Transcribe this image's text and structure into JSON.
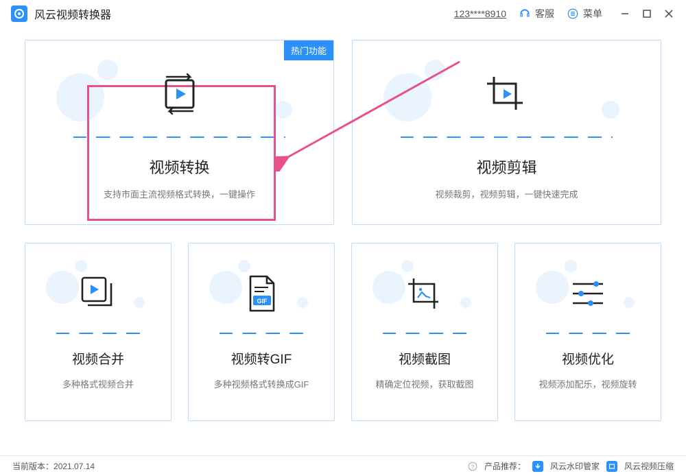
{
  "app": {
    "title": "风云视频转换器"
  },
  "header": {
    "phone": "123****8910",
    "support": "客服",
    "menu": "菜单"
  },
  "badge": "热门功能",
  "cards": {
    "big": [
      {
        "title": "视频转换",
        "desc": "支持市面主流视频格式转换，一键操作"
      },
      {
        "title": "视频剪辑",
        "desc": "视频裁剪，视频剪辑，一键快速完成"
      }
    ],
    "small": [
      {
        "title": "视频合并",
        "desc": "多种格式视频合并"
      },
      {
        "title": "视频转GIF",
        "desc": "多种视频格式转换成GIF"
      },
      {
        "title": "视频截图",
        "desc": "精确定位视频，获取截图"
      },
      {
        "title": "视频优化",
        "desc": "视频添加配乐，视频旋转"
      }
    ]
  },
  "footer": {
    "version_label": "当前版本：",
    "version_value": "2021.07.14",
    "recommend_label": "产品推荐：",
    "rec1": "风云水印管家",
    "rec2": "风云视频压缩"
  }
}
